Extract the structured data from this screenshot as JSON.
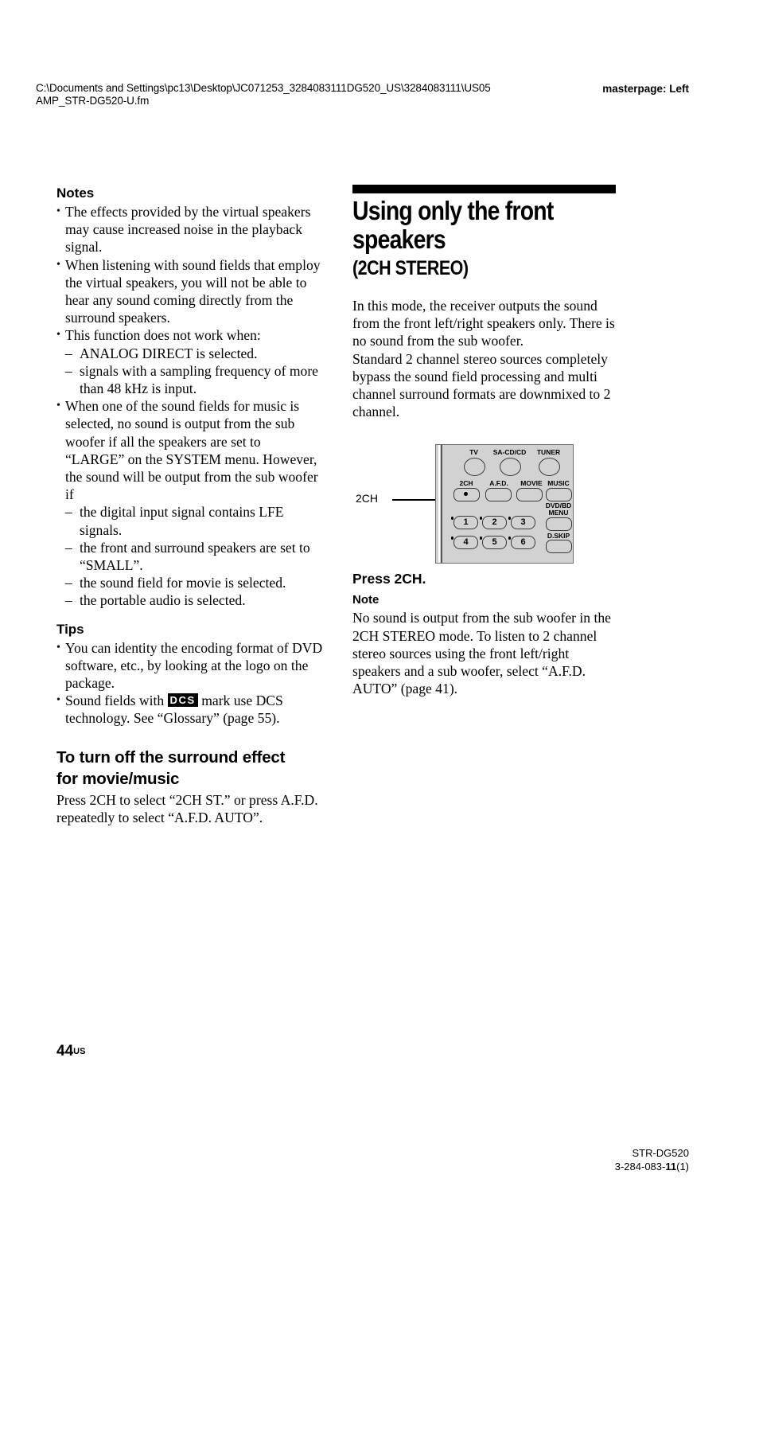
{
  "header": {
    "file_path": "C:\\Documents and Settings\\pc13\\Desktop\\JC071253_3284083111DG520_US\\3284083111\\US05AMP_STR-DG520-U.fm",
    "masterpage": "masterpage: Left"
  },
  "left_column": {
    "notes_heading": "Notes",
    "notes": [
      "The effects provided by the virtual speakers may cause increased noise in the playback signal.",
      "When listening with sound fields that employ the virtual speakers, you will not be able to hear any sound coming directly from the surround speakers.",
      "This function does not work when:",
      "When one of the sound fields for music is selected, no sound is output from the sub woofer if all the speakers are set to “LARGE” on the SYSTEM menu. However, the sound will be output from the sub woofer if"
    ],
    "sub_list_1": [
      "ANALOG DIRECT is selected.",
      "signals with a sampling frequency of more than 48 kHz is input."
    ],
    "sub_list_2": [
      "the digital input signal contains LFE signals.",
      "the front and surround speakers are set to “SMALL”.",
      "the sound field for movie is selected.",
      "the portable audio is selected."
    ],
    "tips_heading": "Tips",
    "tip_1": "You can identity the encoding format of DVD software, etc., by looking at the logo on the package.",
    "tip_2_before": "Sound fields with ",
    "tip_2_badge": "DCS",
    "tip_2_after": " mark use DCS technology. See “Glossary” (page 55).",
    "turnoff_heading_line1": "To turn off the surround effect",
    "turnoff_heading_line2": "for movie/music",
    "turnoff_body": "Press 2CH to select “2CH ST.” or press A.F.D. repeatedly to select “A.F.D. AUTO”."
  },
  "right_column": {
    "chapter_title": "Using only the front speakers",
    "chapter_subtitle": "(2CH STEREO)",
    "intro_para_1": "In this mode, the receiver outputs the sound from the front left/right speakers only. There is no sound from the sub woofer.",
    "intro_para_2": "Standard 2 channel stereo sources completely bypass the sound field processing and multi channel surround formats are downmixed to 2 channel.",
    "press_heading": "Press 2CH.",
    "note_heading": "Note",
    "note_body": "No sound is output from the sub woofer in the 2CH STEREO mode. To listen to 2 channel stereo sources using the front left/right speakers and a sub woofer, select “A.F.D. AUTO” (page 41)."
  },
  "remote": {
    "callout_label": "2CH",
    "buttons_row_circle": [
      "TV",
      "SA-CD/CD",
      "TUNER"
    ],
    "buttons_row_mode": [
      "2CH",
      "A.F.D.",
      "MOVIE",
      "MUSIC"
    ],
    "button_dvd_bd_line1": "DVD/BD",
    "button_dvd_bd_line2": "MENU",
    "button_dskip": "D.SKIP",
    "number_buttons": [
      "1",
      "2",
      "3",
      "4",
      "5",
      "6"
    ],
    "body_color": "#d2d2d2"
  },
  "footer": {
    "page_number": "44",
    "page_suffix": "US",
    "model": "STR-DG520",
    "doc_number_prefix": "3-284-083-",
    "doc_number_bold": "11",
    "doc_number_suffix": "(1)"
  }
}
